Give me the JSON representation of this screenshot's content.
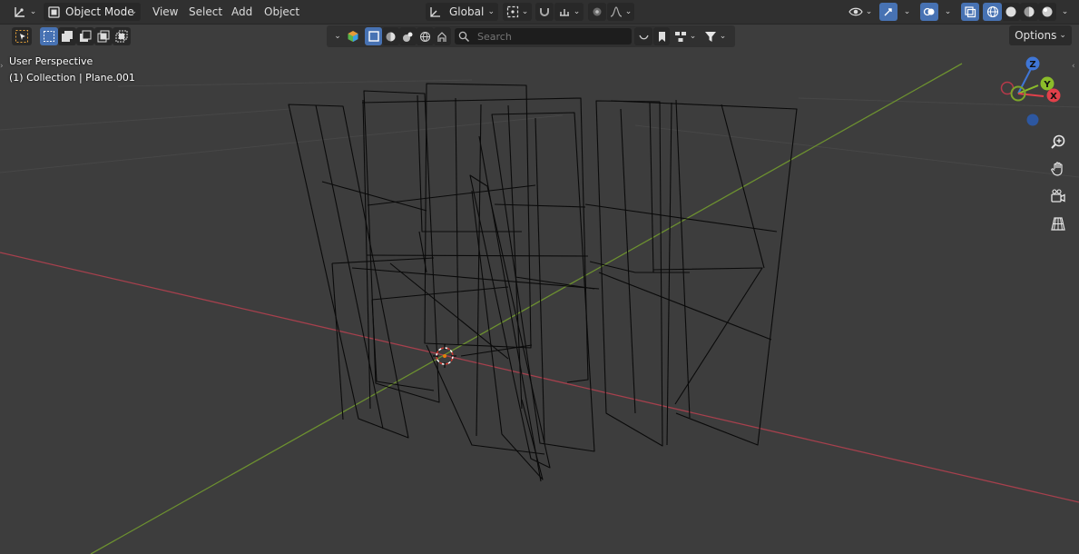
{
  "header": {
    "editor_type_icon": "3d-viewport-icon",
    "mode_label": "Object Mode",
    "menus": [
      "View",
      "Select",
      "Add",
      "Object"
    ],
    "transform_orientation": "Global",
    "options_label": "Options"
  },
  "tool_header": {
    "search_placeholder": "Search"
  },
  "viewport": {
    "perspective_label": "User Perspective",
    "collection_label": "(1) Collection | Plane.001"
  },
  "gizmo": {
    "x_label": "X",
    "y_label": "Y",
    "z_label": "Z",
    "x_color": "#e2404a",
    "y_color": "#8bbc2a",
    "z_color": "#3f76d6"
  },
  "colors": {
    "x_axis": "#a6404d",
    "y_axis": "#6d9130",
    "wire": "#0a0a0a",
    "active": "#4772b3"
  }
}
